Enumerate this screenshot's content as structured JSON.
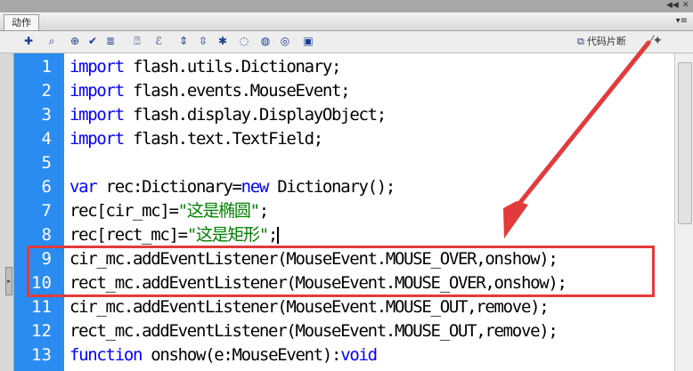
{
  "panel": {
    "tab_label": "动作",
    "menu_glyph": "▾≡"
  },
  "toolbar": {
    "icons": [
      "add-icon",
      "find-icon",
      "target-icon",
      "check-syntax-icon",
      "auto-format-icon",
      "show-hint-icon",
      "debug-icon",
      "collapse-icon",
      "collapse-selection-icon",
      "expand-icon",
      "comment-block-icon",
      "comment-line-icon",
      "uncomment-icon",
      "script-assist-icon"
    ],
    "snippet_label": "代码片断"
  },
  "code": {
    "lines": [
      {
        "n": "1",
        "parts": [
          {
            "t": "import",
            "c": "kw"
          },
          {
            "t": " flash.utils.Dictionary;",
            "c": ""
          }
        ]
      },
      {
        "n": "2",
        "parts": [
          {
            "t": "import",
            "c": "kw"
          },
          {
            "t": " flash.events.MouseEvent;",
            "c": ""
          }
        ]
      },
      {
        "n": "3",
        "parts": [
          {
            "t": "import",
            "c": "kw"
          },
          {
            "t": " flash.display.DisplayObject;",
            "c": ""
          }
        ]
      },
      {
        "n": "4",
        "parts": [
          {
            "t": "import",
            "c": "kw"
          },
          {
            "t": " flash.text.TextField;",
            "c": ""
          }
        ]
      },
      {
        "n": "5",
        "parts": []
      },
      {
        "n": "6",
        "parts": [
          {
            "t": "var",
            "c": "kw"
          },
          {
            "t": " rec:Dictionary=",
            "c": ""
          },
          {
            "t": "new",
            "c": "kw"
          },
          {
            "t": " Dictionary();",
            "c": ""
          }
        ]
      },
      {
        "n": "7",
        "parts": [
          {
            "t": "rec[cir_mc]=",
            "c": ""
          },
          {
            "t": "\"这是椭圆\"",
            "c": "str"
          },
          {
            "t": ";",
            "c": ""
          }
        ]
      },
      {
        "n": "8",
        "parts": [
          {
            "t": "rec[rect_mc]=",
            "c": ""
          },
          {
            "t": "\"这是矩形\"",
            "c": "str"
          },
          {
            "t": ";",
            "c": ""
          }
        ],
        "caret": true
      },
      {
        "n": "9",
        "parts": [
          {
            "t": "cir_mc.addEventListener(MouseEvent.MOUSE_OVER,onshow);",
            "c": ""
          }
        ]
      },
      {
        "n": "10",
        "parts": [
          {
            "t": "rect_mc.addEventListener(MouseEvent.MOUSE_OVER,onshow);",
            "c": ""
          }
        ]
      },
      {
        "n": "11",
        "parts": [
          {
            "t": "cir_mc.addEventListener(MouseEvent.MOUSE_OUT,remove);",
            "c": ""
          }
        ]
      },
      {
        "n": "12",
        "parts": [
          {
            "t": "rect_mc.addEventListener(MouseEvent.MOUSE_OUT,remove);",
            "c": ""
          }
        ]
      },
      {
        "n": "13",
        "parts": [
          {
            "t": "function",
            "c": "kw"
          },
          {
            "t": " onshow(e:MouseEvent):",
            "c": ""
          },
          {
            "t": "void",
            "c": "kw"
          }
        ]
      }
    ]
  },
  "colors": {
    "gutter": "#2a8cf0",
    "keyword": "#0000ff",
    "string": "#008000",
    "annotation": "#e23b3b"
  }
}
